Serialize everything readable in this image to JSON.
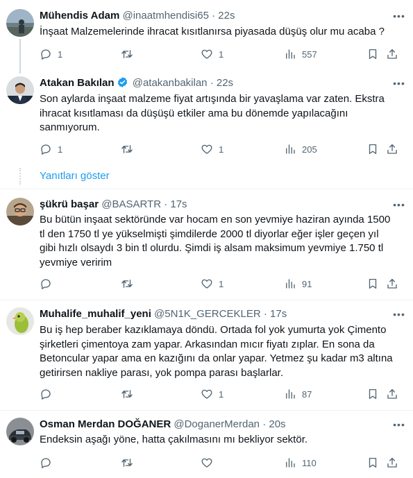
{
  "colors": {
    "accent": "#1d9bf0",
    "text_primary": "#0f1419",
    "text_secondary": "#536471",
    "divider": "#eff3f4"
  },
  "show_replies": "Yanıtları göster",
  "tweets": [
    {
      "name": "Mühendis Adam",
      "handle": "@inaatmhendisi65",
      "dot": "·",
      "time": "22s",
      "verified": false,
      "text": "İnşaat Malzemelerinde ihracat kısıtlanırsa piyasada düşüş olur mu acaba ?",
      "replies": "1",
      "retweets": "",
      "likes": "1",
      "views": "557",
      "avatar": "landscape-photo"
    },
    {
      "name": "Atakan Bakılan",
      "handle": "@atakanbakilan",
      "dot": "·",
      "time": "22s",
      "verified": true,
      "text": "Son aylarda inşaat malzeme fiyat artışında bir yavaşlama var zaten. Ekstra\nihracat kısıtlaması da düşüşü etkiler ama bu dönemde yapılacağını\nsanmıyorum.",
      "replies": "1",
      "retweets": "",
      "likes": "1",
      "views": "205",
      "avatar": "man-in-suit-photo"
    },
    {
      "name": "şükrü başar",
      "handle": "@BASARTR",
      "dot": "·",
      "time": "17s",
      "verified": false,
      "text": "Bu bütün inşaat sektöründe var hocam en son yevmiye haziran ayında 1500\ntl den 1750 tl ye yükselmişti şimdilerde 2000 tl diyorlar eğer işler geçen yıl\ngibi hızlı olsaydı 3 bin tl olurdu. Şimdi iş alsam maksimum yevmiye 1.750 tl\nyevmiye veririm",
      "replies": "",
      "retweets": "",
      "likes": "1",
      "views": "91",
      "avatar": "man-with-glasses-photo"
    },
    {
      "name": "Muhalife_muhalif_yeni",
      "handle": "@5N1K_GERCEKLER",
      "dot": "·",
      "time": "17s",
      "verified": false,
      "text": "Bu iş hep beraber kazıklamaya döndü. Ortada fol yok yumurta yok Çimento\nşirketleri çimentoya zam yapar. Arkasından mıcır fiyatı zıplar. En sona da\nBetoncular yapar ama en kazığını da onlar yapar. Yetmez şu kadar m3 altına\ngetirirsen nakliye parası, yok pompa parası başlarlar.",
      "replies": "",
      "retweets": "",
      "likes": "1",
      "views": "87",
      "avatar": "bird-photo"
    },
    {
      "name": "Osman Merdan DOĞANER",
      "handle": "@DoganerMerdan",
      "dot": "·",
      "time": "20s",
      "verified": false,
      "text": "Endeksin aşağı yöne, hatta çakılmasını mı bekliyor sektör.",
      "replies": "",
      "retweets": "",
      "likes": "",
      "views": "110",
      "avatar": "car-photo"
    }
  ]
}
